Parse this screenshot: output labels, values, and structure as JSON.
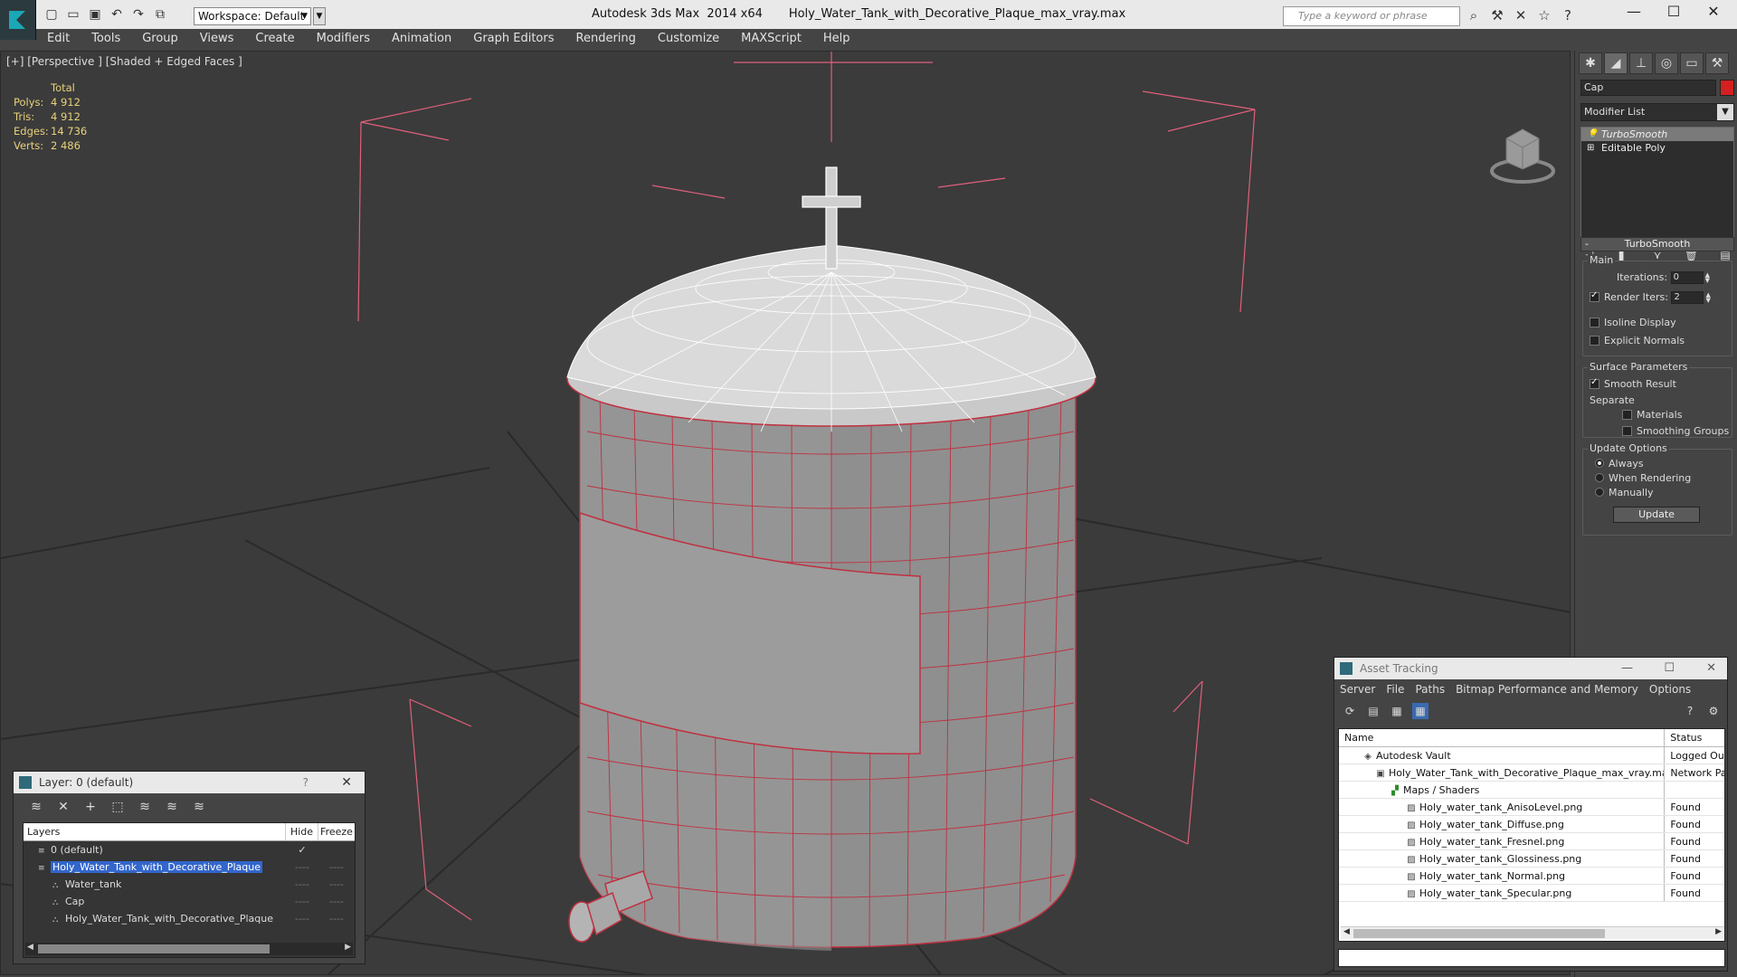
{
  "titlebar": {
    "workspace": "Workspace: Default",
    "title": "Autodesk 3ds Max  2014 x64       Holy_Water_Tank_with_Decorative_Plaque_max_vray.max",
    "search_placeholder": "Type a keyword or phrase"
  },
  "menu": [
    "Edit",
    "Tools",
    "Group",
    "Views",
    "Create",
    "Modifiers",
    "Animation",
    "Graph Editors",
    "Rendering",
    "Customize",
    "MAXScript",
    "Help"
  ],
  "viewport": {
    "label": "[+] [Perspective ] [Shaded + Edged Faces ]",
    "stats": {
      "header": "Total",
      "rows": [
        {
          "k": "Polys:",
          "v": "4 912"
        },
        {
          "k": "Tris:",
          "v": "4 912"
        },
        {
          "k": "Edges:",
          "v": "14 736"
        },
        {
          "k": "Verts:",
          "v": "2 486"
        }
      ]
    }
  },
  "command_panel": {
    "object_name": "Cap",
    "object_color": "#d42020",
    "modifier_list": "Modifier List",
    "stack": [
      "TurboSmooth",
      "Editable Poly"
    ],
    "rollout_title": "TurboSmooth",
    "main_label": "Main",
    "iterations_label": "Iterations:",
    "iterations_value": "0",
    "render_iters_label": "Render Iters:",
    "render_iters_value": "2",
    "isoline_label": "Isoline Display",
    "explicit_normals_label": "Explicit Normals",
    "surface_params_label": "Surface Parameters",
    "smooth_result_label": "Smooth Result",
    "separate_label": "Separate",
    "materials_label": "Materials",
    "smoothing_groups_label": "Smoothing Groups",
    "update_options_label": "Update Options",
    "always_label": "Always",
    "when_rendering_label": "When Rendering",
    "manually_label": "Manually",
    "update_button": "Update"
  },
  "layer_dialog": {
    "title": "Layer: 0 (default)",
    "help": "?",
    "col_layers": "Layers",
    "col_hide": "Hide",
    "col_freeze": "Freeze",
    "rows": [
      {
        "label": "0 (default)",
        "indent": 1
      },
      {
        "label": "Holy_Water_Tank_with_Decorative_Plaque",
        "indent": 1
      },
      {
        "label": "Water_tank",
        "indent": 2
      },
      {
        "label": "Cap",
        "indent": 2
      },
      {
        "label": "Holy_Water_Tank_with_Decorative_Plaque",
        "indent": 2
      }
    ],
    "hide_value": "----",
    "freeze_value": "----"
  },
  "asset_tracking": {
    "title": "Asset Tracking",
    "menu": [
      "Server",
      "File",
      "Paths",
      "Bitmap Performance and Memory",
      "Options"
    ],
    "col_name": "Name",
    "col_status": "Status",
    "rows": [
      {
        "name": "Autodesk Vault",
        "status": "Logged Out",
        "indent": 1,
        "icon": "vault-icon"
      },
      {
        "name": "Holy_Water_Tank_with_Decorative_Plaque_max_vray.max",
        "status": "Network Path",
        "indent": 2,
        "icon": "max-file-icon"
      },
      {
        "name": "Maps / Shaders",
        "status": "",
        "indent": 3,
        "icon": "maps-icon"
      },
      {
        "name": "Holy_water_tank_AnisoLevel.png",
        "status": "Found",
        "indent": 4,
        "icon": "image-file-icon"
      },
      {
        "name": "Holy_water_tank_Diffuse.png",
        "status": "Found",
        "indent": 4,
        "icon": "image-file-icon"
      },
      {
        "name": "Holy_water_tank_Fresnel.png",
        "status": "Found",
        "indent": 4,
        "icon": "image-file-icon"
      },
      {
        "name": "Holy_water_tank_Glossiness.png",
        "status": "Found",
        "indent": 4,
        "icon": "image-file-icon"
      },
      {
        "name": "Holy_water_tank_Normal.png",
        "status": "Found",
        "indent": 4,
        "icon": "image-file-icon"
      },
      {
        "name": "Holy_water_tank_Specular.png",
        "status": "Found",
        "indent": 4,
        "icon": "image-file-icon"
      }
    ]
  }
}
